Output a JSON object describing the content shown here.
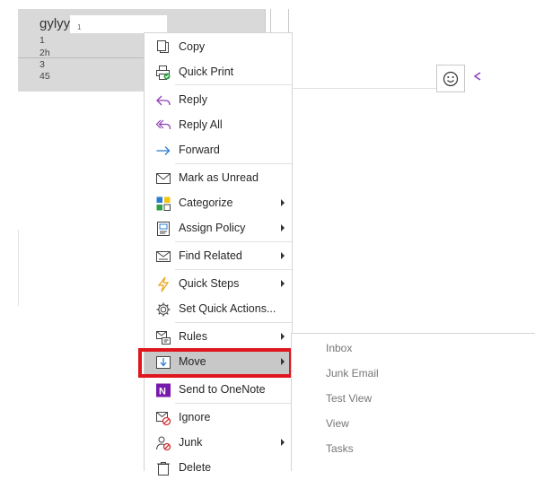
{
  "message": {
    "sender": "gylyy",
    "sender_suffix": "1",
    "lines": [
      "1",
      "2h",
      "3",
      "45"
    ]
  },
  "reading_pane": {
    "emoji_icon": "smiley-icon",
    "reply_icon": "reply-arrow-icon"
  },
  "context_menu": {
    "items": [
      {
        "label": "Copy",
        "icon": "copy-icon"
      },
      {
        "label": "Quick Print",
        "icon": "quick-print-icon"
      },
      {
        "label": "Reply",
        "icon": "reply-icon"
      },
      {
        "label": "Reply All",
        "icon": "reply-all-icon"
      },
      {
        "label": "Forward",
        "icon": "forward-icon"
      },
      {
        "label": "Mark as Unread",
        "icon": "envelope-icon"
      },
      {
        "label": "Categorize",
        "icon": "categorize-icon"
      },
      {
        "label": "Assign Policy",
        "icon": "assign-policy-icon"
      },
      {
        "label": "Find Related",
        "icon": "find-related-icon"
      },
      {
        "label": "Quick Steps",
        "icon": "lightning-icon"
      },
      {
        "label": "Set Quick Actions...",
        "icon": "gear-icon"
      },
      {
        "label": "Rules",
        "icon": "rules-icon"
      },
      {
        "label": "Move",
        "icon": "move-icon"
      },
      {
        "label": "Send to OneNote",
        "icon": "onenote-icon"
      },
      {
        "label": "Ignore",
        "icon": "ignore-icon"
      },
      {
        "label": "Junk",
        "icon": "junk-icon"
      },
      {
        "label": "Delete",
        "icon": "delete-icon"
      }
    ]
  },
  "move_submenu": {
    "items": [
      "Inbox",
      "Junk Email",
      "Test View",
      "View",
      "Tasks"
    ]
  },
  "colors": {
    "highlight_border": "#e0161e",
    "hover_bg": "#c8c8c8",
    "purple": "#8c3fb5",
    "blue": "#2b7cd3",
    "onenote": "#7719aa"
  }
}
